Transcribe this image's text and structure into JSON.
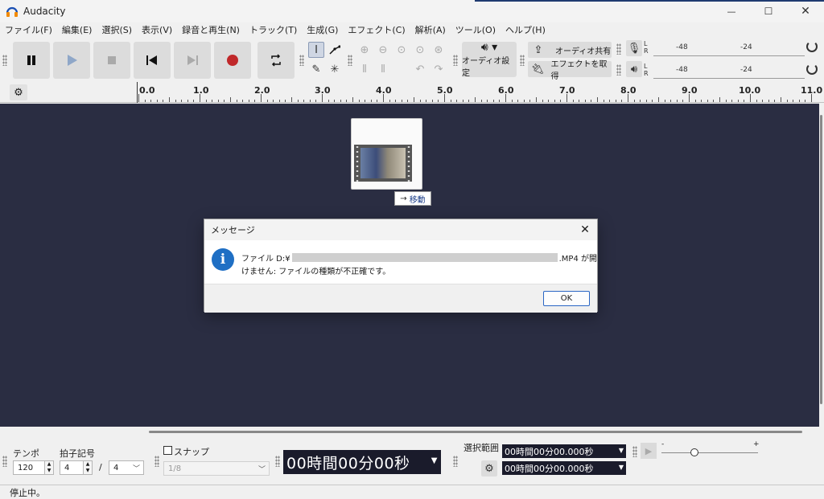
{
  "window": {
    "title": "Audacity",
    "minimize": "—",
    "maximize": "☐",
    "close": "✕"
  },
  "menu": [
    "ファイル(F)",
    "編集(E)",
    "選択(S)",
    "表示(V)",
    "録音と再生(N)",
    "トラック(T)",
    "生成(G)",
    "エフェクト(C)",
    "解析(A)",
    "ツール(O)",
    "ヘルプ(H)"
  ],
  "toolbar": {
    "audio_setup_label": "オーディオ設定",
    "share_audio_label": "オーディオ共有",
    "get_effects_label": "エフェクトを取得",
    "meter_ticks": [
      "-48",
      "-24"
    ],
    "meter_lr": [
      "L",
      "R"
    ]
  },
  "ruler": {
    "labels": [
      "0.0",
      "1.0",
      "2.0",
      "3.0",
      "4.0",
      "5.0",
      "6.0",
      "7.0",
      "8.0",
      "9.0",
      "10.0",
      "11.0"
    ]
  },
  "drag": {
    "tooltip": "移動"
  },
  "dialog": {
    "title": "メッセージ",
    "message_prefix": "ファイル D:¥",
    "message_suffix": ".MP4 が開",
    "message_line2": "けません: ファイルの種類が不正確です。",
    "ok_label": "OK"
  },
  "bottom": {
    "tempo_label": "テンポ",
    "tempo_value": "120",
    "time_sig_label": "拍子記号",
    "time_sig_upper": "4",
    "time_sig_sep": "/",
    "time_sig_lower": "4",
    "snap_label": "スナップ",
    "snap_value": "1/8",
    "time_display": "00時間00分00秒",
    "selection_label": "選択範囲",
    "selection_start": "00時間00分00.000秒",
    "selection_end": "00時間00分00.000秒",
    "speed_minus": "-",
    "speed_plus": "+"
  },
  "status": {
    "text": "停止中。"
  }
}
